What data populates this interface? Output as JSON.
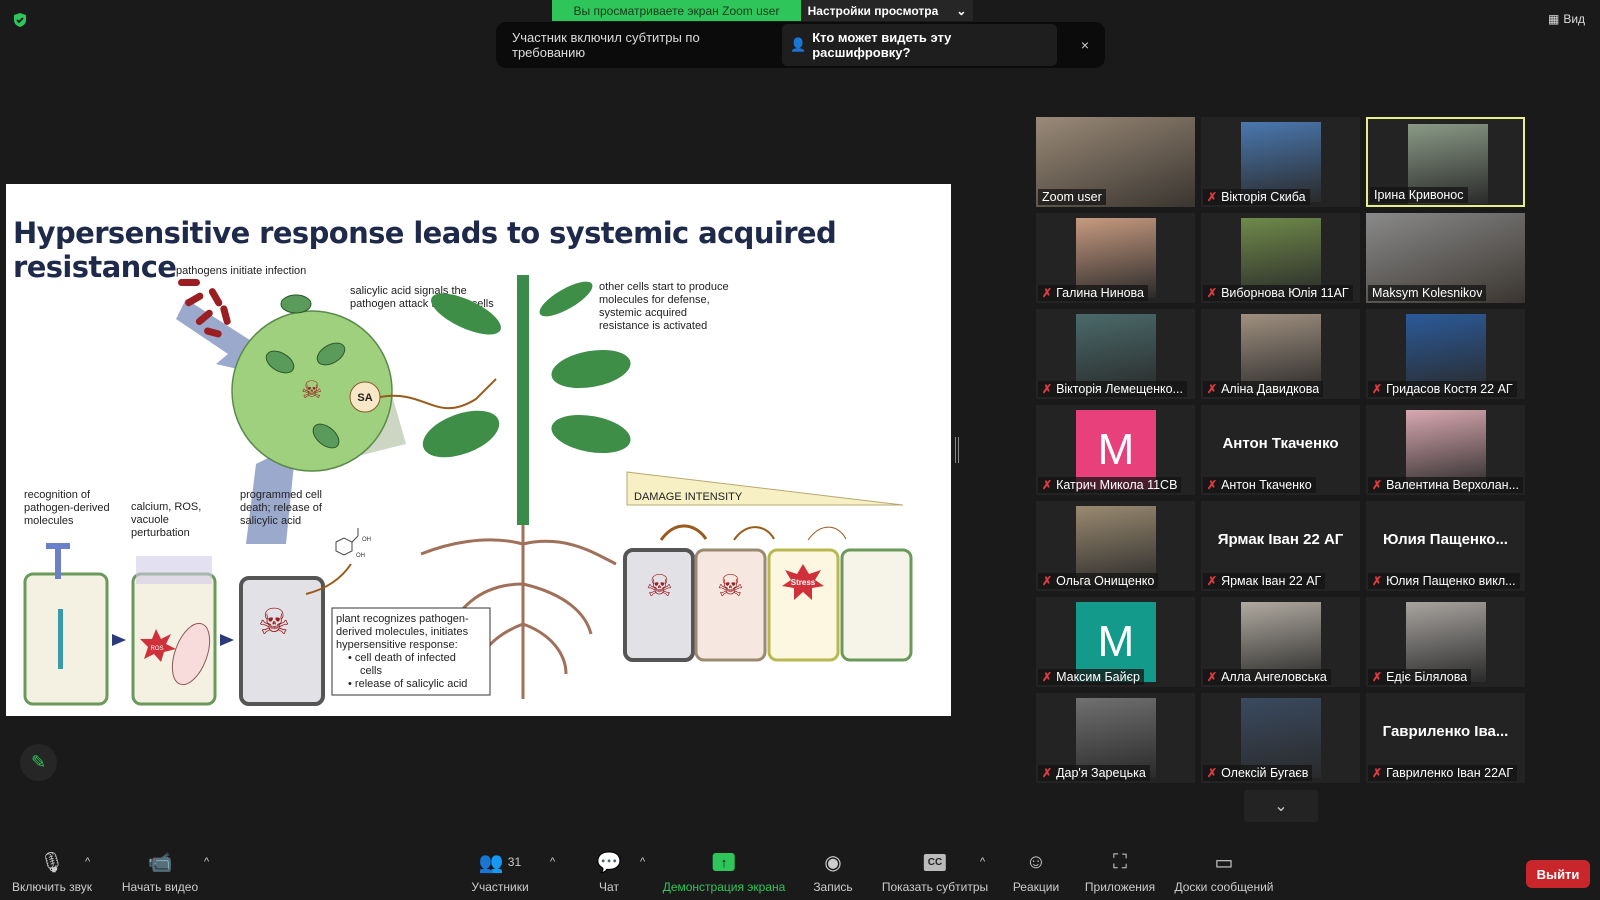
{
  "top": {
    "banner": "Вы просматриваете экран Zoom user",
    "view_settings": "Настройки просмотра",
    "view_button": "Вид",
    "notice": {
      "text": "Участник включил субтитры по требованию",
      "link": "Кто может видеть эту расшифровку?",
      "close": "×"
    }
  },
  "slide": {
    "title": "Hypersensitive response leads to systemic acquired resistance",
    "labels": {
      "pathogens": "pathogens initiate infection",
      "sa_1": "salicylic acid signals the",
      "sa_2": "pathogen attack to other cells",
      "sa": "SA",
      "other_1": "other cells start to produce",
      "other_2": "molecules for defense,",
      "other_3": "systemic acquired",
      "other_4": "resistance is activated",
      "rec_1": "recognition of",
      "rec_2": "pathogen-derived",
      "rec_3": "molecules",
      "cal_1": "calcium, ROS,",
      "cal_2": "vacuole",
      "cal_3": "perturbation",
      "pcd_1": "programmed cell",
      "pcd_2": "death; release of",
      "pcd_3": "salicylic acid",
      "box_1": "plant recognizes pathogen-",
      "box_2": "derived molecules, initiates",
      "box_3": "hypersensitive response:",
      "box_4": "• cell death of infected",
      "box_5": "cells",
      "box_6": "• release of salicylic acid",
      "damage": "DAMAGE INTENSITY",
      "stress": "Stress",
      "ros": "ROS",
      "oh1": "OH",
      "oh2": "OH"
    }
  },
  "gallery": [
    {
      "name": "Zoom user",
      "type": "video",
      "color": "#9a8a78",
      "muted": false
    },
    {
      "name": "Вікторія Скиба",
      "type": "photo",
      "color": "#4a78b0",
      "muted": true
    },
    {
      "name": "Ірина Кривонос",
      "type": "photo",
      "color": "#8a9a86",
      "muted": false,
      "active": true
    },
    {
      "name": "Галина Нинова",
      "type": "photo",
      "color": "#c79a80",
      "muted": true
    },
    {
      "name": "Виборнова Юлія 11АГ",
      "type": "photo",
      "color": "#6f8a4a",
      "muted": true
    },
    {
      "name": "Maksym Kolesnikov",
      "type": "video",
      "color": "#8a8a8a",
      "muted": false
    },
    {
      "name": "Вікторія Лемещенко...",
      "type": "photo",
      "color": "#4a6a6a",
      "muted": true
    },
    {
      "name": "Аліна Давидкова",
      "type": "photo",
      "color": "#a09080",
      "muted": true
    },
    {
      "name": "Гридасов Костя 22 АГ",
      "type": "photo",
      "color": "#2b5a9a",
      "muted": true
    },
    {
      "name": "Катрич Микола 11СВ",
      "type": "avatar",
      "letter": "M",
      "color": "#e8407a",
      "muted": true
    },
    {
      "name": "Антон Ткаченко",
      "type": "name",
      "display": "Антон Ткаченко",
      "muted": true
    },
    {
      "name": "Валентина Верхолан...",
      "type": "photo",
      "color": "#d8a8b0",
      "muted": true
    },
    {
      "name": "Ольга Онищенко",
      "type": "photo",
      "color": "#9a8a70",
      "muted": true
    },
    {
      "name": "Ярмак Іван 22 АГ",
      "type": "name",
      "display": "Ярмак Іван 22 АГ",
      "muted": true
    },
    {
      "name": "Юлия Пащенко викл...",
      "type": "name",
      "display": "Юлия  Пащенко...",
      "muted": true
    },
    {
      "name": "Максим Байєр",
      "type": "avatar",
      "letter": "M",
      "color": "#149a8a",
      "muted": true
    },
    {
      "name": "Алла Ангеловська",
      "type": "photo",
      "color": "#b0aaa0",
      "muted": true
    },
    {
      "name": "Едіє Білялова",
      "type": "photo",
      "color": "#a8a4a0",
      "muted": true
    },
    {
      "name": "Дар'я Зарецька",
      "type": "photo",
      "color": "#707070",
      "muted": true
    },
    {
      "name": "Олексій Бугаєв",
      "type": "photo",
      "color": "#3a4a60",
      "muted": true
    },
    {
      "name": "Гавриленко Іван 22АГ",
      "type": "name",
      "display": "Гавриленко Іва...",
      "muted": true
    }
  ],
  "toolbar": {
    "unmute": "Включить звук",
    "video": "Начать видео",
    "participants": "Участники",
    "participants_count": "31",
    "chat": "Чат",
    "share": "Демонстрация экрана",
    "record": "Запись",
    "captions": "Показать субтитры",
    "captions_icon": "CC",
    "reactions": "Реакции",
    "apps": "Приложения",
    "whiteboards": "Доски сообщений",
    "leave": "Выйти"
  },
  "colors": {
    "share_green": "#2ec55a",
    "leave_red": "#c8262b",
    "active_speaker": "#e6ef8a",
    "muted_red": "#e0393e"
  }
}
